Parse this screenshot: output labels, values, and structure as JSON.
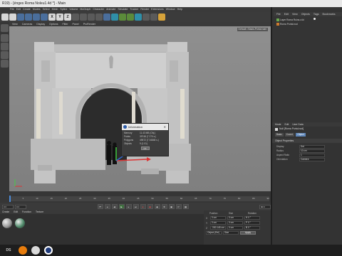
{
  "window": {
    "title": "R19) - [énges Roma Noleu1.4d *] - Main"
  },
  "menu": {
    "items": [
      "File",
      "Edit",
      "Create",
      "Modes",
      "Select",
      "Mesh",
      "Spline",
      "Volume",
      "MoGraph",
      "Character",
      "Animate",
      "Simulate",
      "Tracker",
      "Render",
      "Extensions",
      "Window",
      "Help"
    ]
  },
  "toolbar": {
    "buttons": [
      "undo-icon",
      "redo-icon",
      "select-icon",
      "move-icon",
      "scale-icon",
      "rotate-icon",
      "x-axis",
      "y-axis",
      "z-axis",
      "coord-icon",
      "render-view-icon",
      "render-icon",
      "render-settings-icon",
      "cube-icon",
      "pen-icon",
      "subdivide-icon",
      "array-icon",
      "deformer-icon",
      "floor-icon",
      "camera-icon",
      "light-icon"
    ],
    "axis_labels": [
      "X",
      "Y",
      "Z"
    ]
  },
  "viewport": {
    "menu": [
      "View",
      "Cameras",
      "Display",
      "Options",
      "Filter",
      "Panel",
      "ProRender"
    ],
    "camera_tag": "Default • Basis-Portal.ruini"
  },
  "info_dialog": {
    "title": "Information",
    "rows": [
      {
        "label": "Memory",
        "value": "11.43 MB (Obj.)"
      },
      {
        "label": "Points",
        "value": "39748 (7 270 s.)"
      },
      {
        "label": "Polygons",
        "value": "49572 (7 34848 s.)"
      },
      {
        "label": "Objects",
        "value": "9 (1 01)"
      }
    ],
    "ok": "OK"
  },
  "timeline": {
    "ticks": [
      "0",
      "5",
      "10",
      "15",
      "20",
      "25",
      "30",
      "35",
      "40",
      "45",
      "50",
      "55",
      "60",
      "65",
      "70",
      "75",
      "80",
      "85",
      "90"
    ],
    "current": "0 F",
    "start": "0 F",
    "end": "90 F"
  },
  "materials": {
    "menu": [
      "Create",
      "Edit",
      "Function",
      "Texture"
    ],
    "swatches": [
      {
        "color": "#9a9a9a"
      },
      {
        "color": "#4f8a6a"
      }
    ]
  },
  "coordinates": {
    "headers": [
      "Position",
      "Size",
      "Rotation"
    ],
    "rows": [
      {
        "axis": "X",
        "pos": "0 cm",
        "size": "0 cm",
        "rot": "H 0 °"
      },
      {
        "axis": "Y",
        "pos": "0 cm",
        "size": "0 cm",
        "rot": "P 0 °"
      },
      {
        "axis": "Z",
        "pos": "-330.145 cm",
        "size": "0 cm",
        "rot": "B 0 °"
      }
    ],
    "mode": "Object (Rel)",
    "mode2": "Size",
    "apply": "Apply"
  },
  "object_manager": {
    "menu": [
      "File",
      "Edit",
      "View",
      "Objects",
      "Tags",
      "Bookmarks"
    ],
    "objects": [
      "Layer Roma Ruins.c4d",
      "Roma Portal.nod"
    ]
  },
  "attributes": {
    "menu": [
      "Mode",
      "Edit",
      "User Data"
    ],
    "object_name": "Null [Roma Portal.nod]",
    "tabs": [
      "Basic",
      "Coord.",
      "Object"
    ],
    "section": "Object Properties",
    "props": [
      {
        "label": "Display",
        "value": "Dot"
      },
      {
        "label": "Radius",
        "value": "10 cm"
      },
      {
        "label": "Aspect Ratio",
        "value": "1"
      },
      {
        "label": "Orientation",
        "value": "Camera"
      }
    ]
  },
  "taskbar": {
    "apps": [
      "DS",
      "blender-icon",
      "unity-icon",
      "cinema4d-icon"
    ]
  }
}
